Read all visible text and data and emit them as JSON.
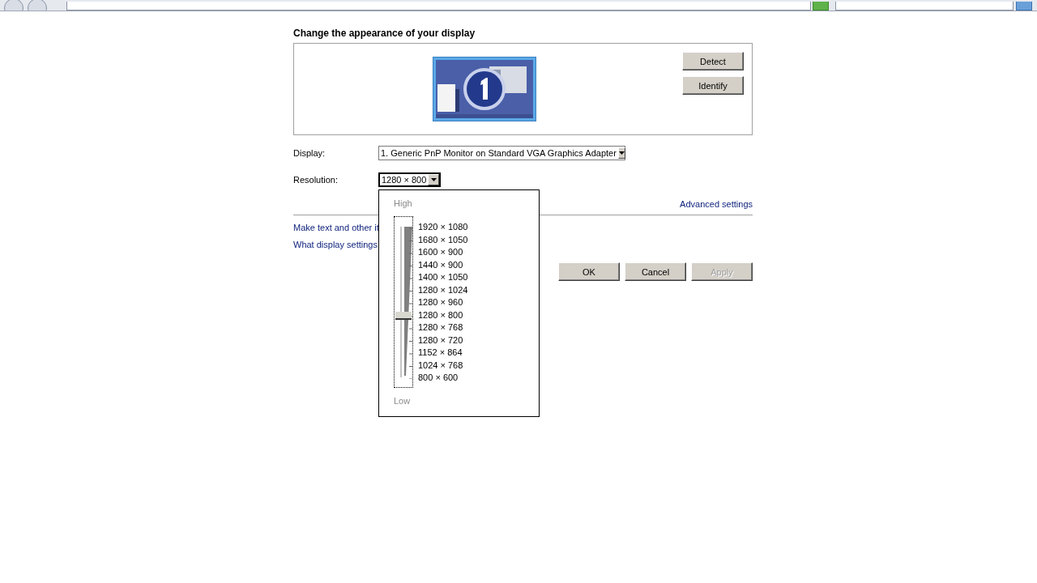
{
  "page": {
    "title": "Change the appearance of your display"
  },
  "monitor_buttons": [
    "Detect",
    "Identify"
  ],
  "display": {
    "label": "Display:",
    "value": "1. Generic PnP Monitor on Standard VGA Graphics Adapter"
  },
  "resolution": {
    "label": "Resolution:",
    "value": "1280 × 800",
    "expanded": true,
    "popup": {
      "high_label": "High",
      "low_label": "Low",
      "level": 0.42,
      "options": [
        "1920 × 1080",
        "1680 × 1050",
        "1600 × 900",
        "1440 × 900",
        "1400 × 1050",
        "1280 × 1024",
        "1280 × 960",
        "1280 × 800",
        "1280 × 768",
        "1280 × 720",
        "1152 × 864",
        "1024 × 768",
        "800 × 600"
      ]
    }
  },
  "advanced_link": "Advanced settings",
  "links": [
    "Make text and other it",
    "What display settings"
  ],
  "buttons": [
    {
      "label": "OK",
      "disabled": false
    },
    {
      "label": "Cancel",
      "disabled": false
    },
    {
      "label": "Apply",
      "disabled": true
    }
  ]
}
